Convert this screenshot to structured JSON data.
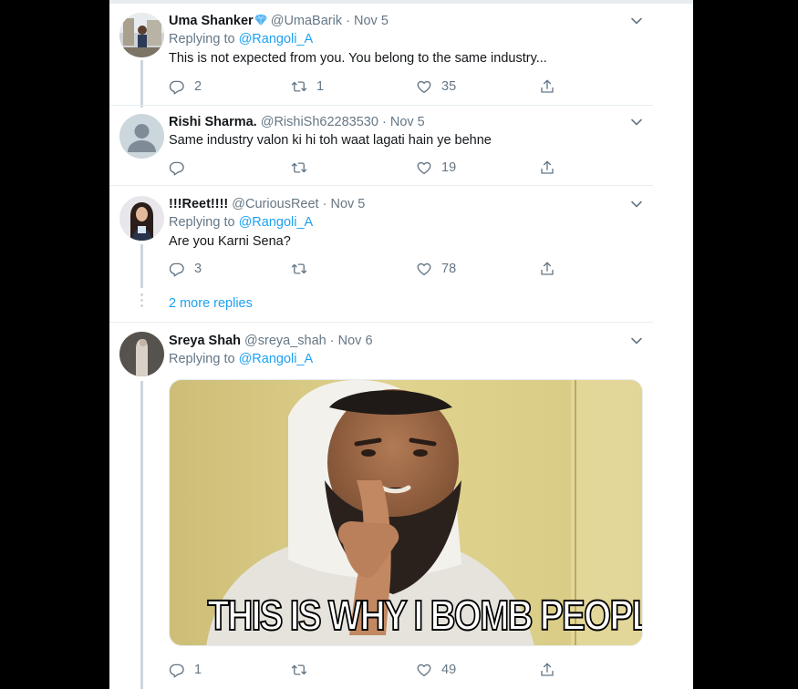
{
  "tweets": [
    {
      "name": "Uma Shanker",
      "handle": "@UmaBarik",
      "date": "Nov 5",
      "replying_label": "Replying to",
      "replying_to": "@Rangoli_A",
      "text": "This is not expected from you. You belong to the same industry...",
      "replies": "2",
      "retweets": "1",
      "likes": "35"
    },
    {
      "name": "Rishi Sharma.",
      "handle": "@RishiSh62283530",
      "date": "Nov 5",
      "text": "Same industry valon ki hi toh waat lagati hain ye behne",
      "replies": "",
      "retweets": "",
      "likes": "19"
    },
    {
      "name": "!!!Reet!!!!",
      "handle": "@CuriousReet",
      "date": "Nov 5",
      "replying_label": "Replying to",
      "replying_to": "@Rangoli_A",
      "text": "Are you Karni Sena?",
      "replies": "3",
      "retweets": "",
      "likes": "78"
    },
    {
      "name": "Sreya Shah",
      "handle": "@sreya_shah",
      "date": "Nov 6",
      "replying_label": "Replying to",
      "replying_to": "@Rangoli_A",
      "media_caption": "THIS IS WHY I BOMB PEOPLE",
      "replies": "1",
      "retweets": "",
      "likes": "49"
    }
  ],
  "more_replies": "2 more replies",
  "separator": "·",
  "colors": {
    "link": "#1da1f2",
    "muted": "#657786",
    "border": "#e6ecf0",
    "thread": "#ccd6dd"
  }
}
